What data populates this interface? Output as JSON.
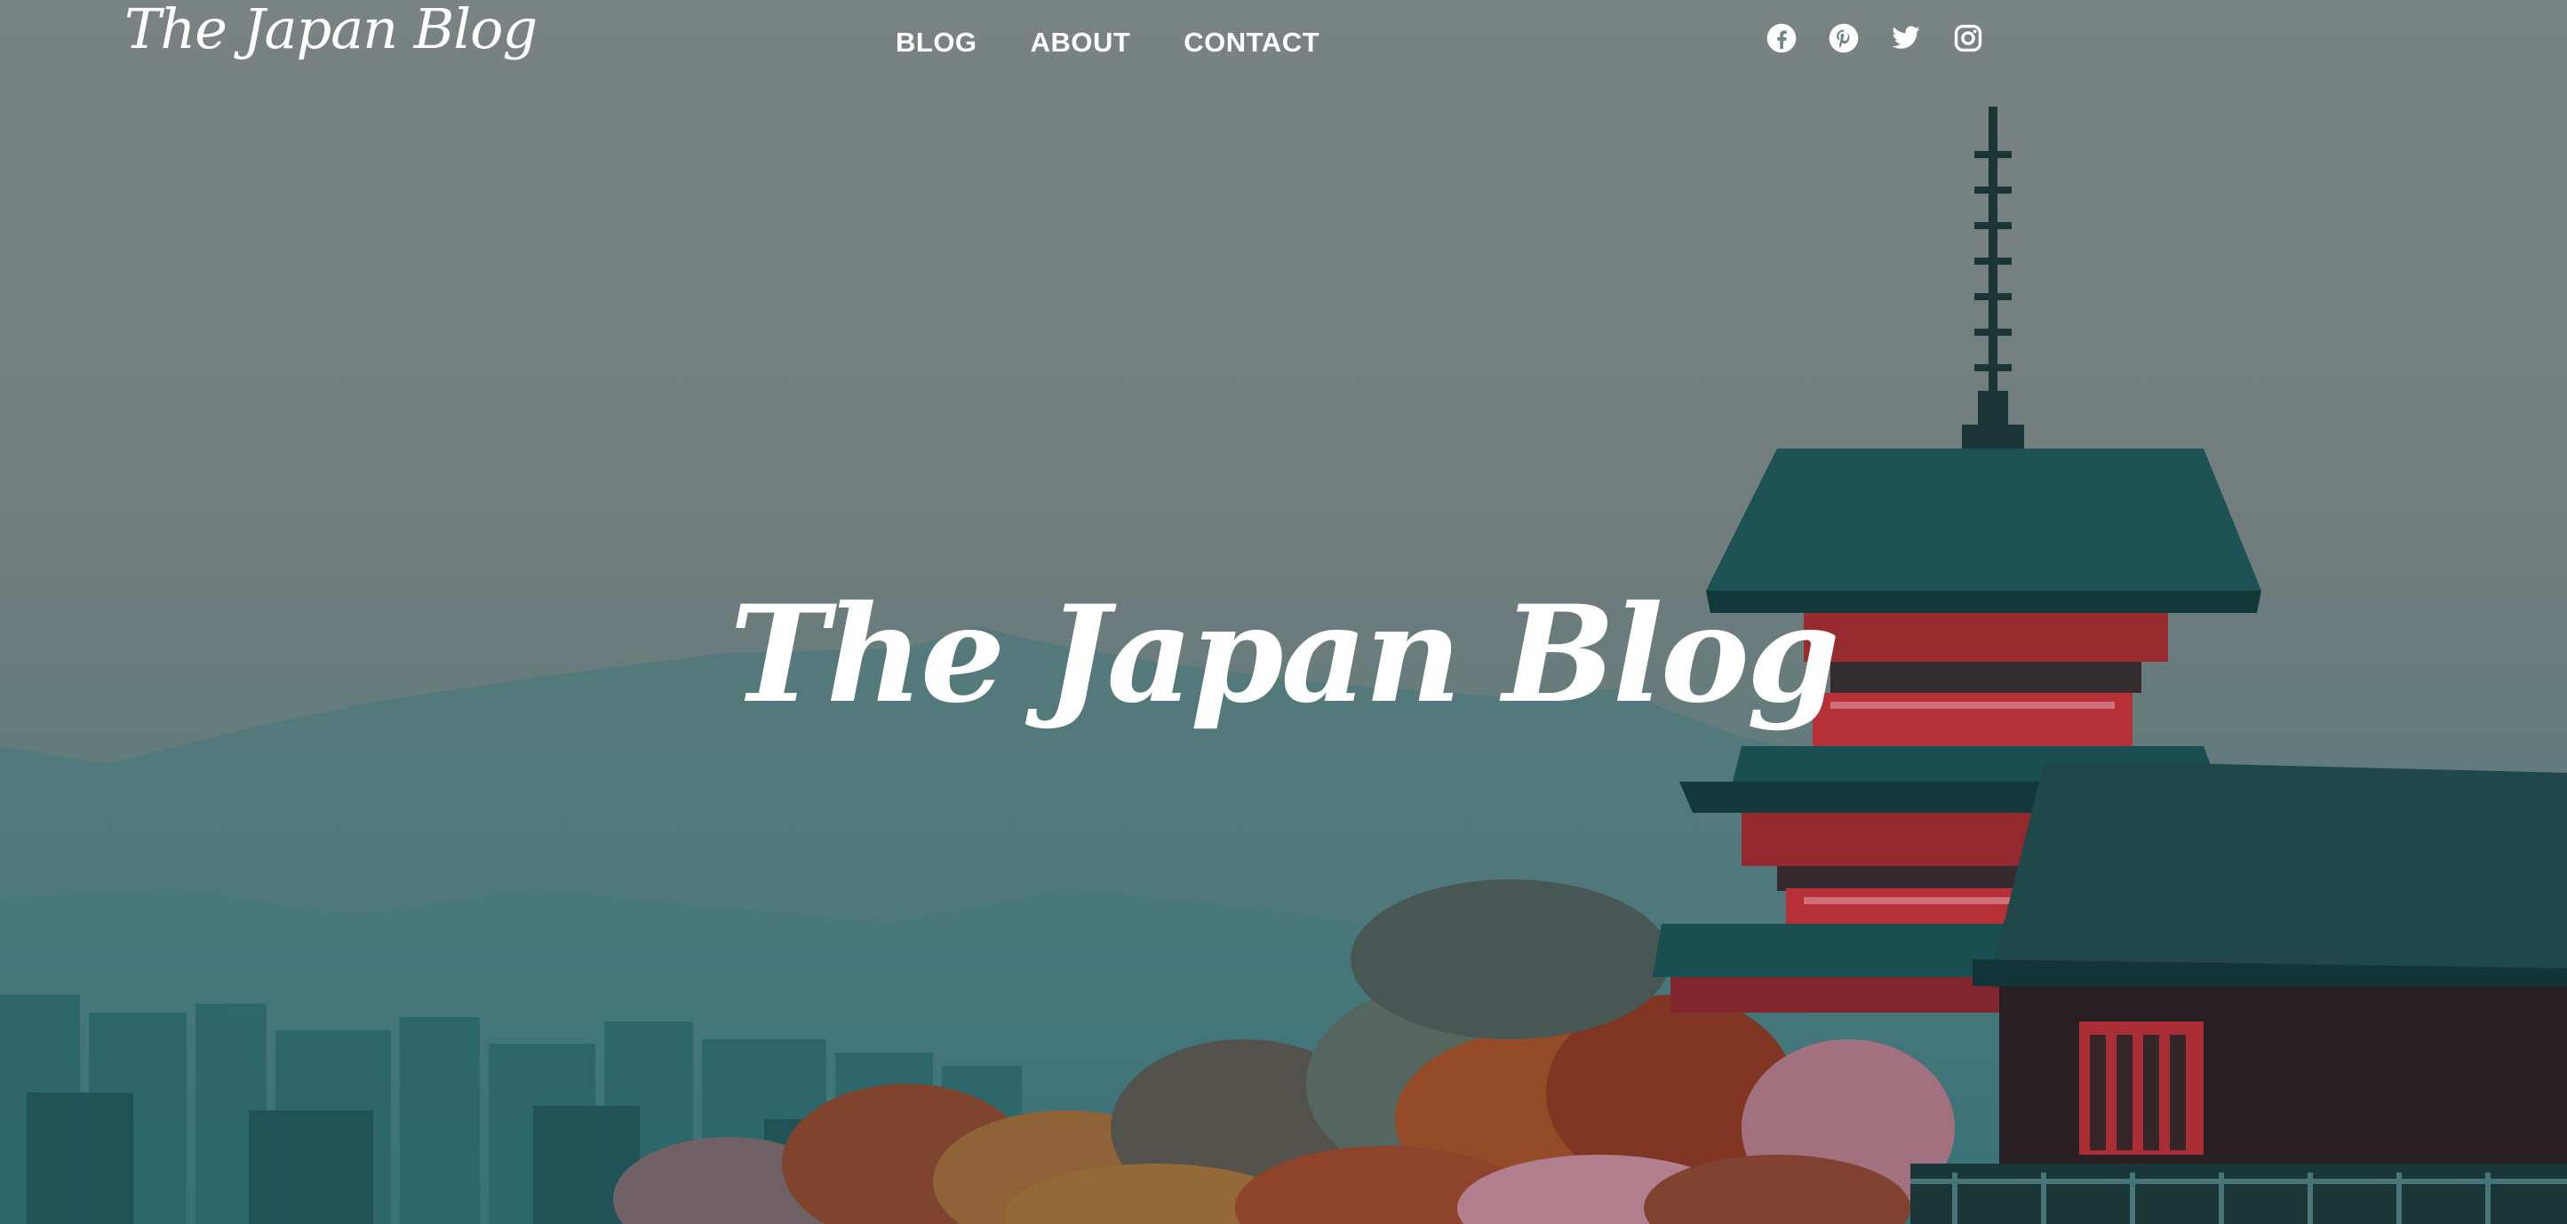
{
  "site": {
    "logo_text": "The Japan Blog",
    "hero_title": "The Japan Blog"
  },
  "nav": {
    "items": [
      {
        "label": "BLOG"
      },
      {
        "label": "ABOUT"
      },
      {
        "label": "CONTACT"
      }
    ]
  },
  "social": {
    "icons": [
      "facebook-icon",
      "pinterest-icon",
      "twitter-icon",
      "instagram-icon"
    ]
  },
  "colors": {
    "text": "#ffffff",
    "sky": "#7e8c8c",
    "mountain": "#5f8588",
    "pagoda_red": "#b8323a",
    "roof_teal": "#1f5a5c"
  }
}
